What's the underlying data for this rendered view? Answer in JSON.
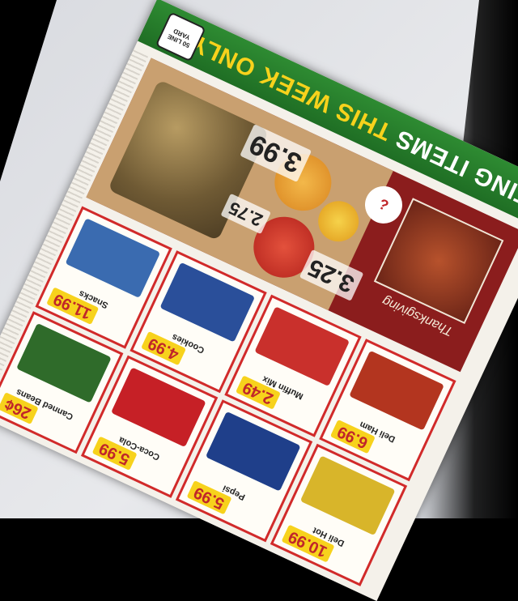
{
  "banner": {
    "headline_prefix": "ATING ITEMS ",
    "headline_highlight": "THIS WEEK ONLY!",
    "logo_text": "50 LINE YARD"
  },
  "hero": {
    "price_grain": "3.99",
    "price_small": "2.75",
    "price_fruit": "3.25",
    "script_text": "Thanksgiving",
    "badge": "?"
  },
  "grid": {
    "cells": [
      {
        "label": "Snacks",
        "price": "11.99",
        "color": "#3a6bb0"
      },
      {
        "label": "Cookies",
        "price": "4.99",
        "color": "#2a4f9a"
      },
      {
        "label": "Muffin Mix",
        "price": "2.49",
        "color": "#c9302c"
      },
      {
        "label": "Deli Ham",
        "price": "6.99",
        "color": "#b3351f"
      },
      {
        "label": "Canned Beans",
        "price": "26¢",
        "color": "#2f6b2a"
      },
      {
        "label": "Coca-Cola",
        "price": "5.99",
        "color": "#c62026"
      },
      {
        "label": "Pepsi",
        "price": "5.99",
        "color": "#1f3f8a"
      },
      {
        "label": "Deli Hot",
        "price": "10.99",
        "color": "#d8b52a"
      }
    ]
  }
}
